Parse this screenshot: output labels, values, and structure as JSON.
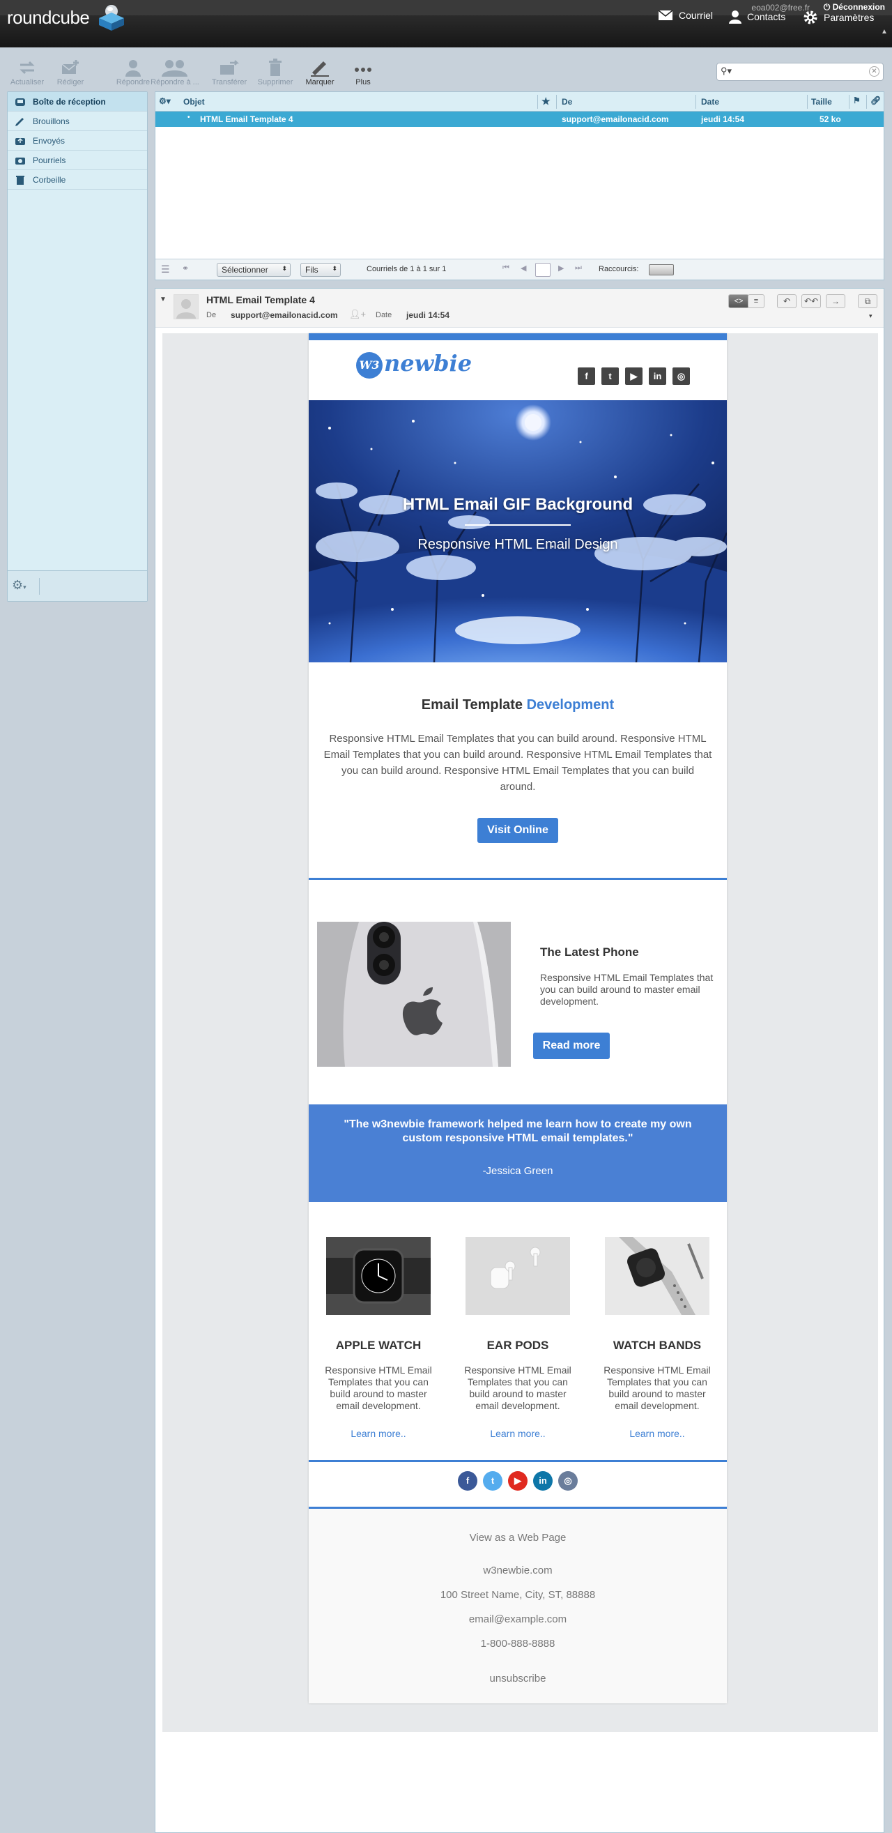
{
  "topbar": {
    "user": "eoa002@free.fr",
    "logout": "Déconnexion"
  },
  "header": {
    "logo": "roundcube",
    "nav": [
      "Courriel",
      "Contacts",
      "Paramètres"
    ]
  },
  "toolbar": {
    "actualiser": "Actualiser",
    "rediger": "Rédiger",
    "repondre": "Répondre",
    "repondre_a": "Répondre à ...",
    "transferer": "Transférer",
    "supprimer": "Supprimer",
    "marquer": "Marquer",
    "plus": "Plus"
  },
  "folders": [
    "Boîte de réception",
    "Brouillons",
    "Envoyés",
    "Pourriels",
    "Corbeille"
  ],
  "list": {
    "columns": {
      "subject": "Objet",
      "from": "De",
      "date": "Date",
      "size": "Taille"
    },
    "row": {
      "subject": "HTML Email Template 4",
      "from": "support@emailonacid.com",
      "date": "jeudi 14:54",
      "size": "52 ko"
    },
    "footer": {
      "select": "Sélectionner",
      "threads": "Fils",
      "count": "Courriels de 1 à 1 sur 1",
      "shortcuts": "Raccourcis:"
    }
  },
  "message": {
    "subject": "HTML Email Template 4",
    "from_label": "De",
    "from": "support@emailonacid.com",
    "date_label": "Date",
    "date": "jeudi 14:54"
  },
  "email": {
    "brand_w3": "W3",
    "brand_name": "newbie",
    "social": [
      "f",
      "t",
      "▶",
      "in",
      "◎"
    ],
    "hero": {
      "title": "HTML Email GIF Background",
      "subtitle": "Responsive HTML Email Design"
    },
    "intro": {
      "heading_1": "Email Template ",
      "heading_2": "Development",
      "text": "Responsive HTML Email Templates that you can build around. Responsive HTML Email Templates that you can build around. Responsive HTML Email Templates that you can build around. Responsive HTML Email Templates that you can build around.",
      "button": "Visit Online"
    },
    "phone": {
      "title": "The Latest Phone",
      "text": "Responsive HTML Email Templates that you can build around to master email development.",
      "button": "Read more"
    },
    "quote": {
      "text": "\"The w3newbie framework helped me learn how to create my own custom responsive HTML email templates.\"",
      "author": "-Jessica Green"
    },
    "products": [
      {
        "title": "APPLE WATCH",
        "text": "Responsive HTML Email Templates that you can build around to master email development.",
        "link": "Learn more.."
      },
      {
        "title": "EAR PODS",
        "text": "Responsive HTML Email Templates that you can build around to master email development.",
        "link": "Learn more.."
      },
      {
        "title": "WATCH BANDS",
        "text": "Responsive HTML Email Templates that you can build around to master email development.",
        "link": "Learn more.."
      }
    ],
    "footer": {
      "webpage": "View as a Web Page",
      "site": "w3newbie.com",
      "address": "100 Street Name, City, ST, 88888",
      "email": "email@example.com",
      "phone": "1-800-888-8888",
      "unsubscribe": "unsubscribe"
    },
    "colors": {
      "accent": "#3d7fd4",
      "selection": "#3ba9d3"
    }
  }
}
